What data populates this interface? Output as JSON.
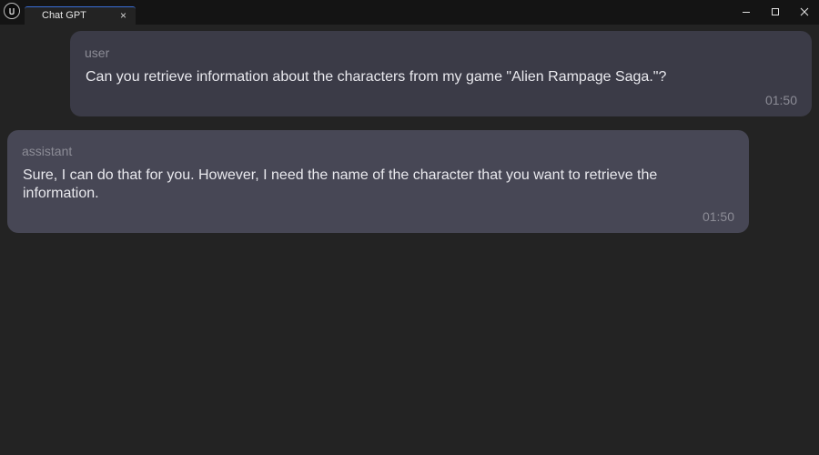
{
  "window": {
    "tab_title": "Chat GPT",
    "tab_close_label": "×",
    "icons": {
      "logo": "unreal-logo-icon",
      "minimize": "minimize-icon",
      "maximize": "maximize-icon",
      "close": "close-icon"
    }
  },
  "messages": [
    {
      "role": "user",
      "text": "Can you retrieve information about the characters from my game \"Alien Rampage Saga.\"?",
      "time": "01:50"
    },
    {
      "role": "assistant",
      "text": "Sure, I can do that for you. However, I need the name of the character that you want to retrieve the information.",
      "time": "01:50"
    }
  ],
  "colors": {
    "background": "#232323",
    "titlebar": "#141414",
    "user_bubble": "#3b3b47",
    "assistant_bubble": "#474755",
    "text": "#e9e9ee",
    "muted_text": "#8c8c96",
    "tab_accent": "#3a6fd8"
  }
}
